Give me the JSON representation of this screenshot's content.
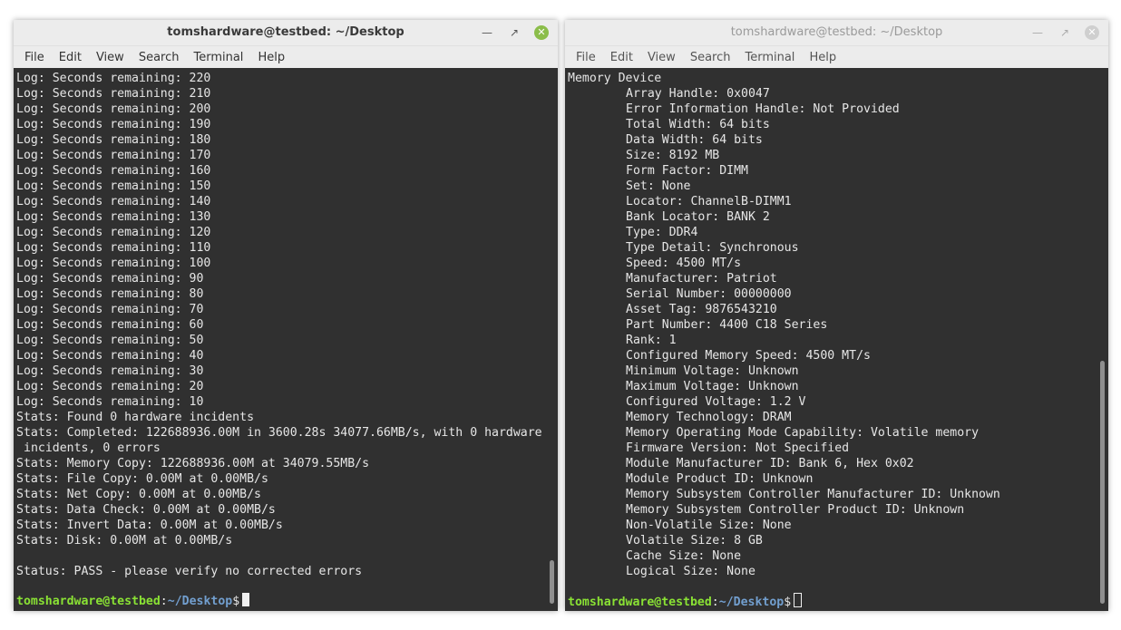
{
  "left_window": {
    "title": "tomshardware@testbed: ~/Desktop",
    "menu": [
      "File",
      "Edit",
      "View",
      "Search",
      "Terminal",
      "Help"
    ],
    "lines": [
      "Log: Seconds remaining: 220",
      "Log: Seconds remaining: 210",
      "Log: Seconds remaining: 200",
      "Log: Seconds remaining: 190",
      "Log: Seconds remaining: 180",
      "Log: Seconds remaining: 170",
      "Log: Seconds remaining: 160",
      "Log: Seconds remaining: 150",
      "Log: Seconds remaining: 140",
      "Log: Seconds remaining: 130",
      "Log: Seconds remaining: 120",
      "Log: Seconds remaining: 110",
      "Log: Seconds remaining: 100",
      "Log: Seconds remaining: 90",
      "Log: Seconds remaining: 80",
      "Log: Seconds remaining: 70",
      "Log: Seconds remaining: 60",
      "Log: Seconds remaining: 50",
      "Log: Seconds remaining: 40",
      "Log: Seconds remaining: 30",
      "Log: Seconds remaining: 20",
      "Log: Seconds remaining: 10",
      "Stats: Found 0 hardware incidents",
      "Stats: Completed: 122688936.00M in 3600.28s 34077.66MB/s, with 0 hardware",
      "incidents, 0 errors",
      "Stats: Memory Copy: 122688936.00M at 34079.55MB/s",
      "Stats: File Copy: 0.00M at 0.00MB/s",
      "Stats: Net Copy: 0.00M at 0.00MB/s",
      "Stats: Data Check: 0.00M at 0.00MB/s",
      "Stats: Invert Data: 0.00M at 0.00MB/s",
      "Stats: Disk: 0.00M at 0.00MB/s",
      "",
      "Status: PASS - please verify no corrected errors"
    ],
    "prompt": {
      "user": "tomshardware@testbed",
      "sep": ":",
      "path": "~/Desktop",
      "symbol": "$"
    }
  },
  "right_window": {
    "title": "tomshardware@testbed: ~/Desktop",
    "menu": [
      "File",
      "Edit",
      "View",
      "Search",
      "Terminal",
      "Help"
    ],
    "header": "Memory Device",
    "lines": [
      "Array Handle: 0x0047",
      "Error Information Handle: Not Provided",
      "Total Width: 64 bits",
      "Data Width: 64 bits",
      "Size: 8192 MB",
      "Form Factor: DIMM",
      "Set: None",
      "Locator: ChannelB-DIMM1",
      "Bank Locator: BANK 2",
      "Type: DDR4",
      "Type Detail: Synchronous",
      "Speed: 4500 MT/s",
      "Manufacturer: Patriot",
      "Serial Number: 00000000",
      "Asset Tag: 9876543210",
      "Part Number: 4400 C18 Series",
      "Rank: 1",
      "Configured Memory Speed: 4500 MT/s",
      "Minimum Voltage: Unknown",
      "Maximum Voltage: Unknown",
      "Configured Voltage: 1.2 V",
      "Memory Technology: DRAM",
      "Memory Operating Mode Capability: Volatile memory",
      "Firmware Version: Not Specified",
      "Module Manufacturer ID: Bank 6, Hex 0x02",
      "Module Product ID: Unknown",
      "Memory Subsystem Controller Manufacturer ID: Unknown",
      "Memory Subsystem Controller Product ID: Unknown",
      "Non-Volatile Size: None",
      "Volatile Size: 8 GB",
      "Cache Size: None",
      "Logical Size: None"
    ],
    "prompt": {
      "user": "tomshardware@testbed",
      "sep": ":",
      "path": "~/Desktop",
      "symbol": "$"
    }
  },
  "colors": {
    "terminal_bg": "#303030",
    "prompt_user": "#8ae234",
    "prompt_path": "#729fcf",
    "close_active": "#8bbd4a"
  },
  "icons": {
    "minimize": "minimize-icon",
    "maximize": "maximize-icon",
    "close": "close-icon"
  }
}
